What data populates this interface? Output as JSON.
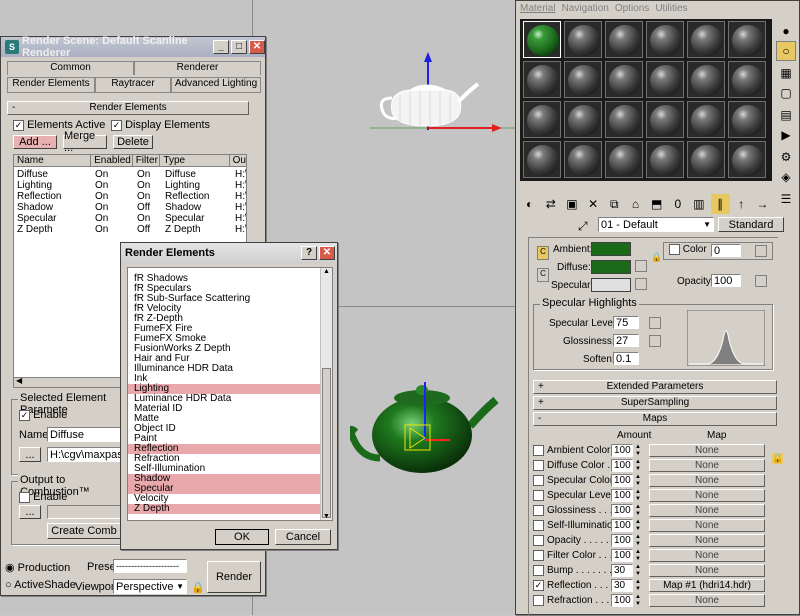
{
  "colors": {
    "green": "#1a6a1a",
    "highlight": "#e8a8ac",
    "title_blue": "#7c8ab0"
  },
  "render_scene": {
    "title": "Render Scene: Default Scanline Renderer",
    "tabs_row1": [
      "Common",
      "Renderer"
    ],
    "tabs_row2": [
      "Render Elements",
      "Raytracer",
      "Advanced Lighting"
    ],
    "rollout_title": "Render Elements",
    "elements_active": "Elements Active",
    "display_elements": "Display Elements",
    "add": "Add ...",
    "merge": "Merge ...",
    "delete": "Delete",
    "columns": [
      "Name",
      "Enabled",
      "Filter",
      "Type",
      "Ou"
    ],
    "rows": [
      [
        "Diffuse",
        "On",
        "On",
        "Diffuse",
        "H:\\"
      ],
      [
        "Lighting",
        "On",
        "On",
        "Lighting",
        "H:\\"
      ],
      [
        "Reflection",
        "On",
        "On",
        "Reflection",
        "H:\\"
      ],
      [
        "Shadow",
        "On",
        "Off",
        "Shadow",
        "H:\\"
      ],
      [
        "Specular",
        "On",
        "On",
        "Specular",
        "H:\\"
      ],
      [
        "Z Depth",
        "On",
        "Off",
        "Z Depth",
        "H:\\"
      ]
    ],
    "selected_group": "Selected Element Paramete",
    "enable": "Enable",
    "name_label": "Name:",
    "name_value": "Diffuse",
    "path_value": "H:\\cgv\\maxpass\\0",
    "browse": "...",
    "combustion_group": "Output to Combustion™",
    "combustion_enable": "Enable",
    "create_combustion": "Create Comb",
    "production": "Production",
    "activeshade": "ActiveShade",
    "preset_label": "Preset:",
    "preset_value": "---------------------",
    "viewport_label": "Viewport:",
    "viewport_value": "Perspective",
    "render": "Render"
  },
  "render_elements_dialog": {
    "title": "Render Elements",
    "help": "?",
    "items": [
      {
        "label": "fR Shadows",
        "sel": false
      },
      {
        "label": "fR Speculars",
        "sel": false
      },
      {
        "label": "fR Sub-Surface Scattering",
        "sel": false
      },
      {
        "label": "fR Velocity",
        "sel": false
      },
      {
        "label": "fR Z-Depth",
        "sel": false
      },
      {
        "label": "FumeFX Fire",
        "sel": false
      },
      {
        "label": "FumeFX Smoke",
        "sel": false
      },
      {
        "label": "FusionWorks Z Depth",
        "sel": false
      },
      {
        "label": "Hair and Fur",
        "sel": false
      },
      {
        "label": "Illuminance HDR Data",
        "sel": false
      },
      {
        "label": "Ink",
        "sel": false
      },
      {
        "label": "Lighting",
        "sel": true
      },
      {
        "label": "Luminance HDR Data",
        "sel": false
      },
      {
        "label": "Material ID",
        "sel": false
      },
      {
        "label": "Matte",
        "sel": false
      },
      {
        "label": "Object ID",
        "sel": false
      },
      {
        "label": "Paint",
        "sel": false
      },
      {
        "label": "Reflection",
        "sel": true
      },
      {
        "label": "Refraction",
        "sel": false
      },
      {
        "label": "Self-Illumination",
        "sel": false
      },
      {
        "label": "Shadow",
        "sel": true
      },
      {
        "label": "Specular",
        "sel": true
      },
      {
        "label": "Velocity",
        "sel": false
      },
      {
        "label": "Z Depth",
        "sel": true
      }
    ],
    "ok": "OK",
    "cancel": "Cancel"
  },
  "material_editor": {
    "menu": [
      "Material",
      "Navigation",
      "Options",
      "Utilities"
    ],
    "material_name": "01 - Default",
    "material_type": "Standard",
    "ambient": "Ambient:",
    "diffuse": "Diffuse:",
    "specular": "Specular:",
    "self_illum_color": "Color",
    "self_illum_value": "0",
    "opacity_label": "Opacity:",
    "opacity_value": "100",
    "specular_highlights": "Specular Highlights",
    "specular_level_label": "Specular Level:",
    "specular_level": "75",
    "glossiness_label": "Glossiness:",
    "glossiness": "27",
    "soften_label": "Soften:",
    "soften": "0.1",
    "extended": "Extended Parameters",
    "supersampling": "SuperSampling",
    "maps": "Maps",
    "amount_header": "Amount",
    "map_header": "Map",
    "map_rows": [
      {
        "label": "Ambient Color . .",
        "amount": "100",
        "map": "None",
        "checked": false
      },
      {
        "label": "Diffuse Color . .",
        "amount": "100",
        "map": "None",
        "checked": false
      },
      {
        "label": "Specular Color . .",
        "amount": "100",
        "map": "None",
        "checked": false
      },
      {
        "label": "Specular Level .",
        "amount": "100",
        "map": "None",
        "checked": false
      },
      {
        "label": "Glossiness . . . .",
        "amount": "100",
        "map": "None",
        "checked": false
      },
      {
        "label": "Self-Illumination .",
        "amount": "100",
        "map": "None",
        "checked": false
      },
      {
        "label": "Opacity . . . . . .",
        "amount": "100",
        "map": "None",
        "checked": false
      },
      {
        "label": "Filter Color . . .",
        "amount": "100",
        "map": "None",
        "checked": false
      },
      {
        "label": "Bump . . . . . . .",
        "amount": "30",
        "map": "None",
        "checked": false
      },
      {
        "label": "Reflection . . . .",
        "amount": "30",
        "map": "Map #1 (hdri14.hdr)",
        "checked": true
      },
      {
        "label": "Refraction . . . .",
        "amount": "100",
        "map": "None",
        "checked": false
      }
    ]
  }
}
